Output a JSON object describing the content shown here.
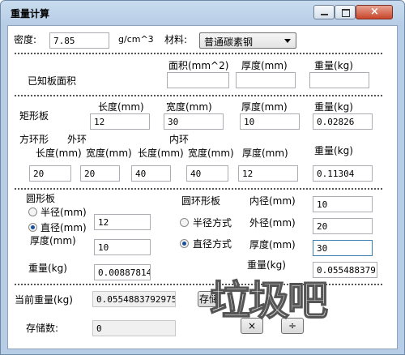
{
  "window": {
    "title": "重量计算"
  },
  "top": {
    "density_label": "密度:",
    "density_value": "7.85",
    "density_unit": "g/cm^3",
    "material_label": "材料:",
    "material_value": "普通碳素钢"
  },
  "known_area": {
    "label": "已知板面积",
    "area_header": "面积(mm^2)",
    "thickness_header": "厚度(mm)",
    "weight_header": "重量(kg)",
    "area_value": "",
    "thickness_value": "",
    "weight_value": ""
  },
  "rect": {
    "label": "矩形板",
    "length_header": "长度(mm)",
    "width_header": "宽度(mm)",
    "thickness_header": "厚度(mm)",
    "weight_header": "重量(kg)",
    "length_value": "12",
    "width_value": "30",
    "thickness_value": "10",
    "weight_value": "0.02826"
  },
  "square_ring": {
    "label": "方环形",
    "outer_label": "外环",
    "inner_label": "内环",
    "outer_length_header": "长度(mm)",
    "outer_width_header": "宽度(mm)",
    "inner_length_header": "长度(mm)",
    "inner_width_header": "宽度(mm)",
    "thickness_header": "厚度(mm)",
    "weight_header": "重量(kg)",
    "outer_length_value": "20",
    "outer_width_value": "20",
    "inner_length_value": "40",
    "inner_width_value": "40",
    "thickness_value": "12",
    "weight_value": "0.11304"
  },
  "circle": {
    "label": "圆形板",
    "radius_label": "半径(mm)",
    "diameter_label": "直径(mm)",
    "size_value": "12",
    "thickness_label": "厚度(mm)",
    "thickness_value": "10",
    "weight_label": "重量(kg)",
    "weight_value": "0.008878140"
  },
  "ring": {
    "label": "圆环形板",
    "radius_mode": "半径方式",
    "diameter_mode": "直径方式",
    "inner_label": "内径(mm)",
    "inner_value": "10",
    "outer_label": "外径(mm)",
    "outer_value": "20",
    "thickness_label": "厚度(mm)",
    "thickness_value": "30",
    "weight_label": "重量(kg)",
    "weight_value": "0.055488379"
  },
  "bottom": {
    "current_label": "当前重量(kg)",
    "current_value": "0.0554883792975",
    "store_button": "存储",
    "count_label": "存储数:",
    "count_value": "0",
    "multiply_button": "×",
    "divide_button": "÷"
  },
  "watermark": "垃圾吧"
}
